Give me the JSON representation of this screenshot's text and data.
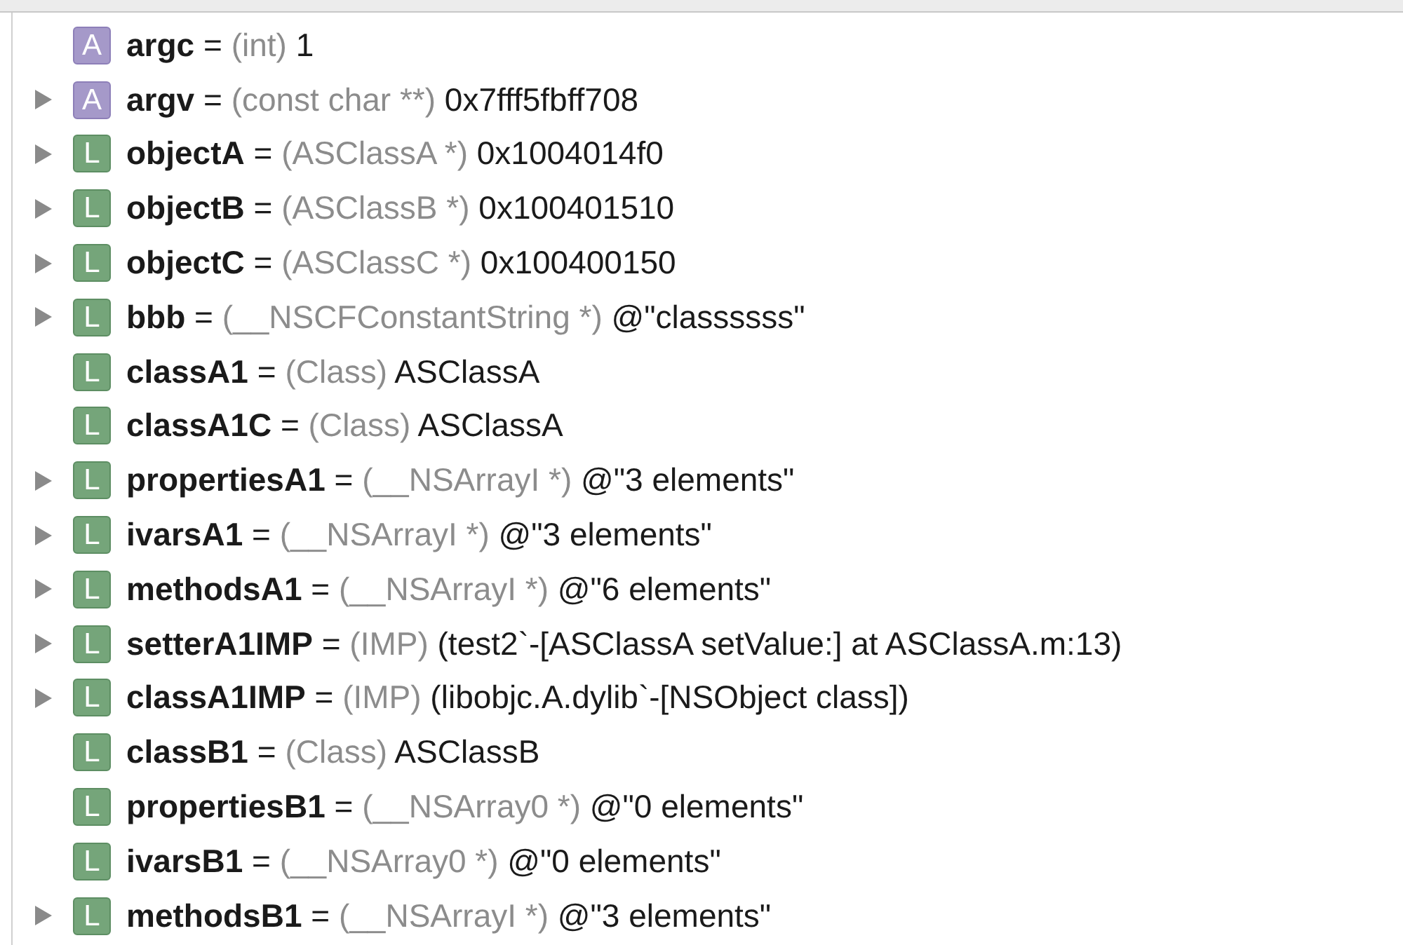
{
  "separator_note": "=",
  "variables": [
    {
      "kind": "argument",
      "badge": "A",
      "expandable": false,
      "name": "argc",
      "type": "(int)",
      "value": "1"
    },
    {
      "kind": "argument",
      "badge": "A",
      "expandable": true,
      "name": "argv",
      "type": "(const char **)",
      "value": "0x7fff5fbff708"
    },
    {
      "kind": "local",
      "badge": "L",
      "expandable": true,
      "name": "objectA",
      "type": "(ASClassA *)",
      "value": "0x1004014f0"
    },
    {
      "kind": "local",
      "badge": "L",
      "expandable": true,
      "name": "objectB",
      "type": "(ASClassB *)",
      "value": "0x100401510"
    },
    {
      "kind": "local",
      "badge": "L",
      "expandable": true,
      "name": "objectC",
      "type": "(ASClassC *)",
      "value": "0x100400150"
    },
    {
      "kind": "local",
      "badge": "L",
      "expandable": true,
      "name": "bbb",
      "type": "(__NSCFConstantString *)",
      "value": "@\"classssss\""
    },
    {
      "kind": "local",
      "badge": "L",
      "expandable": false,
      "name": "classA1",
      "type": "(Class)",
      "value": "ASClassA"
    },
    {
      "kind": "local",
      "badge": "L",
      "expandable": false,
      "name": "classA1C",
      "type": "(Class)",
      "value": "ASClassA"
    },
    {
      "kind": "local",
      "badge": "L",
      "expandable": true,
      "name": "propertiesA1",
      "type": "(__NSArrayI *)",
      "value": "@\"3 elements\""
    },
    {
      "kind": "local",
      "badge": "L",
      "expandable": true,
      "name": "ivarsA1",
      "type": "(__NSArrayI *)",
      "value": "@\"3 elements\""
    },
    {
      "kind": "local",
      "badge": "L",
      "expandable": true,
      "name": "methodsA1",
      "type": "(__NSArrayI *)",
      "value": "@\"6 elements\""
    },
    {
      "kind": "local",
      "badge": "L",
      "expandable": true,
      "name": "setterA1IMP",
      "type": "(IMP)",
      "value": "(test2`-[ASClassA setValue:] at ASClassA.m:13)"
    },
    {
      "kind": "local",
      "badge": "L",
      "expandable": true,
      "name": "classA1IMP",
      "type": "(IMP)",
      "value": "(libobjc.A.dylib`-[NSObject class])"
    },
    {
      "kind": "local",
      "badge": "L",
      "expandable": false,
      "name": "classB1",
      "type": "(Class)",
      "value": "ASClassB"
    },
    {
      "kind": "local",
      "badge": "L",
      "expandable": false,
      "name": "propertiesB1",
      "type": "(__NSArray0 *)",
      "value": "@\"0 elements\""
    },
    {
      "kind": "local",
      "badge": "L",
      "expandable": false,
      "name": "ivarsB1",
      "type": "(__NSArray0 *)",
      "value": "@\"0 elements\""
    },
    {
      "kind": "local",
      "badge": "L",
      "expandable": true,
      "name": "methodsB1",
      "type": "(__NSArrayI *)",
      "value": "@\"3 elements\""
    }
  ]
}
